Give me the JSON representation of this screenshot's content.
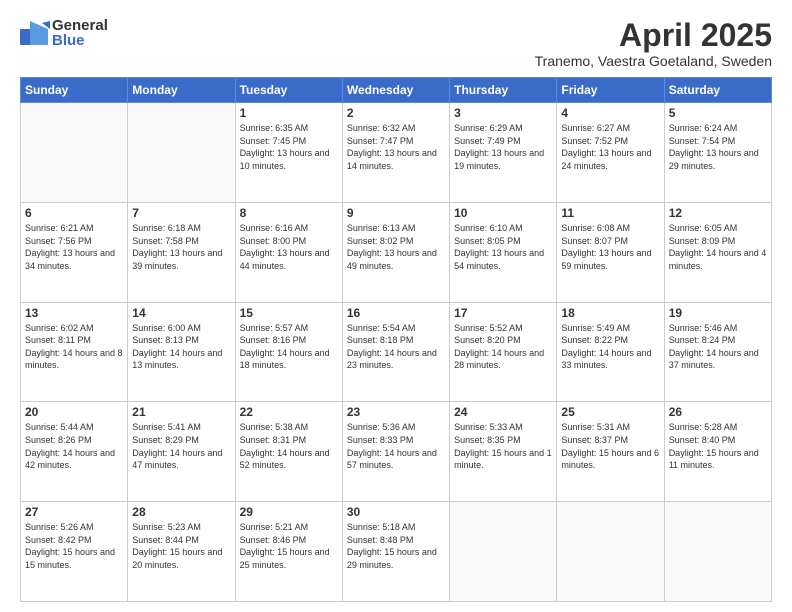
{
  "header": {
    "logo_general": "General",
    "logo_blue": "Blue",
    "month_title": "April 2025",
    "location": "Tranemo, Vaestra Goetaland, Sweden"
  },
  "weekdays": [
    "Sunday",
    "Monday",
    "Tuesday",
    "Wednesday",
    "Thursday",
    "Friday",
    "Saturday"
  ],
  "weeks": [
    [
      {
        "day": "",
        "info": ""
      },
      {
        "day": "",
        "info": ""
      },
      {
        "day": "1",
        "info": "Sunrise: 6:35 AM\nSunset: 7:45 PM\nDaylight: 13 hours and 10 minutes."
      },
      {
        "day": "2",
        "info": "Sunrise: 6:32 AM\nSunset: 7:47 PM\nDaylight: 13 hours and 14 minutes."
      },
      {
        "day": "3",
        "info": "Sunrise: 6:29 AM\nSunset: 7:49 PM\nDaylight: 13 hours and 19 minutes."
      },
      {
        "day": "4",
        "info": "Sunrise: 6:27 AM\nSunset: 7:52 PM\nDaylight: 13 hours and 24 minutes."
      },
      {
        "day": "5",
        "info": "Sunrise: 6:24 AM\nSunset: 7:54 PM\nDaylight: 13 hours and 29 minutes."
      }
    ],
    [
      {
        "day": "6",
        "info": "Sunrise: 6:21 AM\nSunset: 7:56 PM\nDaylight: 13 hours and 34 minutes."
      },
      {
        "day": "7",
        "info": "Sunrise: 6:18 AM\nSunset: 7:58 PM\nDaylight: 13 hours and 39 minutes."
      },
      {
        "day": "8",
        "info": "Sunrise: 6:16 AM\nSunset: 8:00 PM\nDaylight: 13 hours and 44 minutes."
      },
      {
        "day": "9",
        "info": "Sunrise: 6:13 AM\nSunset: 8:02 PM\nDaylight: 13 hours and 49 minutes."
      },
      {
        "day": "10",
        "info": "Sunrise: 6:10 AM\nSunset: 8:05 PM\nDaylight: 13 hours and 54 minutes."
      },
      {
        "day": "11",
        "info": "Sunrise: 6:08 AM\nSunset: 8:07 PM\nDaylight: 13 hours and 59 minutes."
      },
      {
        "day": "12",
        "info": "Sunrise: 6:05 AM\nSunset: 8:09 PM\nDaylight: 14 hours and 4 minutes."
      }
    ],
    [
      {
        "day": "13",
        "info": "Sunrise: 6:02 AM\nSunset: 8:11 PM\nDaylight: 14 hours and 8 minutes."
      },
      {
        "day": "14",
        "info": "Sunrise: 6:00 AM\nSunset: 8:13 PM\nDaylight: 14 hours and 13 minutes."
      },
      {
        "day": "15",
        "info": "Sunrise: 5:57 AM\nSunset: 8:16 PM\nDaylight: 14 hours and 18 minutes."
      },
      {
        "day": "16",
        "info": "Sunrise: 5:54 AM\nSunset: 8:18 PM\nDaylight: 14 hours and 23 minutes."
      },
      {
        "day": "17",
        "info": "Sunrise: 5:52 AM\nSunset: 8:20 PM\nDaylight: 14 hours and 28 minutes."
      },
      {
        "day": "18",
        "info": "Sunrise: 5:49 AM\nSunset: 8:22 PM\nDaylight: 14 hours and 33 minutes."
      },
      {
        "day": "19",
        "info": "Sunrise: 5:46 AM\nSunset: 8:24 PM\nDaylight: 14 hours and 37 minutes."
      }
    ],
    [
      {
        "day": "20",
        "info": "Sunrise: 5:44 AM\nSunset: 8:26 PM\nDaylight: 14 hours and 42 minutes."
      },
      {
        "day": "21",
        "info": "Sunrise: 5:41 AM\nSunset: 8:29 PM\nDaylight: 14 hours and 47 minutes."
      },
      {
        "day": "22",
        "info": "Sunrise: 5:38 AM\nSunset: 8:31 PM\nDaylight: 14 hours and 52 minutes."
      },
      {
        "day": "23",
        "info": "Sunrise: 5:36 AM\nSunset: 8:33 PM\nDaylight: 14 hours and 57 minutes."
      },
      {
        "day": "24",
        "info": "Sunrise: 5:33 AM\nSunset: 8:35 PM\nDaylight: 15 hours and 1 minute."
      },
      {
        "day": "25",
        "info": "Sunrise: 5:31 AM\nSunset: 8:37 PM\nDaylight: 15 hours and 6 minutes."
      },
      {
        "day": "26",
        "info": "Sunrise: 5:28 AM\nSunset: 8:40 PM\nDaylight: 15 hours and 11 minutes."
      }
    ],
    [
      {
        "day": "27",
        "info": "Sunrise: 5:26 AM\nSunset: 8:42 PM\nDaylight: 15 hours and 15 minutes."
      },
      {
        "day": "28",
        "info": "Sunrise: 5:23 AM\nSunset: 8:44 PM\nDaylight: 15 hours and 20 minutes."
      },
      {
        "day": "29",
        "info": "Sunrise: 5:21 AM\nSunset: 8:46 PM\nDaylight: 15 hours and 25 minutes."
      },
      {
        "day": "30",
        "info": "Sunrise: 5:18 AM\nSunset: 8:48 PM\nDaylight: 15 hours and 29 minutes."
      },
      {
        "day": "",
        "info": ""
      },
      {
        "day": "",
        "info": ""
      },
      {
        "day": "",
        "info": ""
      }
    ]
  ]
}
